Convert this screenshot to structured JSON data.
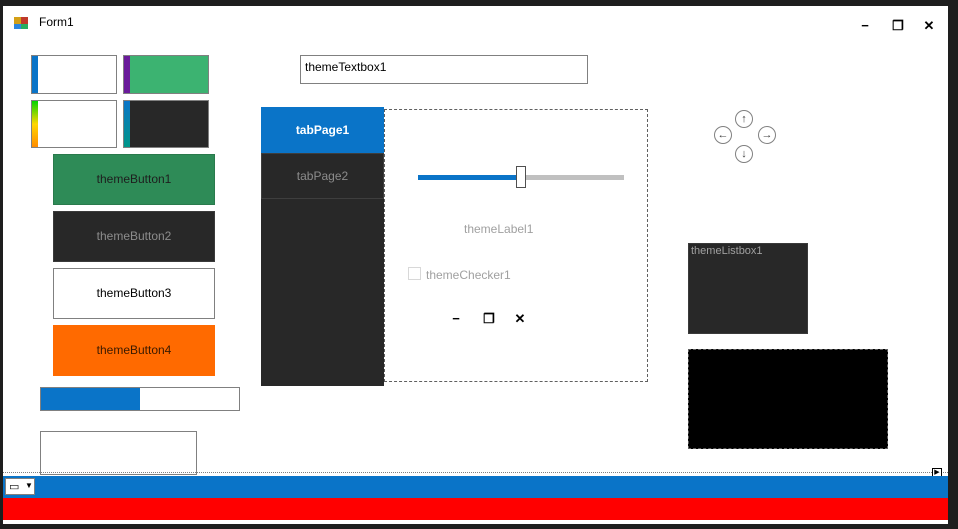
{
  "window": {
    "title": "Form1"
  },
  "title_controls": {
    "minimize": "−",
    "restore": "❐",
    "close": "✕"
  },
  "buttons": [
    {
      "label": "themeButton1",
      "bg": "#2e8b57",
      "fg": "#1e1e1e"
    },
    {
      "label": "themeButton2",
      "bg": "#282828",
      "fg": "#8c8c8c"
    },
    {
      "label": "themeButton3",
      "bg": "#ffffff",
      "fg": "#000000"
    },
    {
      "label": "themeButton4",
      "bg": "#ff6a00",
      "fg": "#3a1a00"
    }
  ],
  "textbox": {
    "value": "themeTextbox1"
  },
  "tabs": [
    {
      "label": "tabPage1",
      "selected": true
    },
    {
      "label": "tabPage2",
      "selected": false
    }
  ],
  "slider": {
    "value": 0.5
  },
  "label1": "themeLabel1",
  "checker": {
    "label": "themeChecker1",
    "checked": false
  },
  "inner_controls": {
    "minimize": "−",
    "restore": "❐",
    "close": "✕"
  },
  "listbox": {
    "label": "themeListbox1"
  },
  "progress": {
    "value": 0.5
  },
  "arrows": {
    "up": "↑",
    "left": "←",
    "right": "→",
    "down": "↓"
  },
  "colors": {
    "accent": "#0a74c8",
    "status_bar": "#0a74c8",
    "bottom_band": "#ff0000",
    "dark": "#282828",
    "green": "#3cb371"
  }
}
